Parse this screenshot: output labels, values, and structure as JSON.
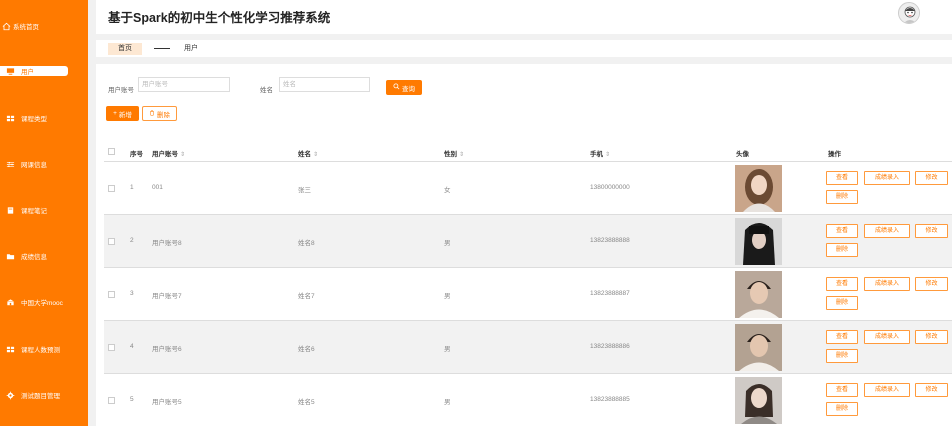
{
  "app": {
    "title": "基于Spark的初中生个性化学习推荐系统"
  },
  "sidebar": {
    "items": [
      {
        "label": "系统首页",
        "icon": "home-icon"
      },
      {
        "label": "用户",
        "icon": "monitor-icon"
      },
      {
        "label": "课程类型",
        "icon": "grid-icon"
      },
      {
        "label": "网课信息",
        "icon": "sliders-icon"
      },
      {
        "label": "课程笔记",
        "icon": "notebook-icon"
      },
      {
        "label": "成绩信息",
        "icon": "folder-icon"
      },
      {
        "label": "中国大学mooc",
        "icon": "school-icon"
      },
      {
        "label": "课程人数预测",
        "icon": "grid-icon"
      },
      {
        "label": "测试题目管理",
        "icon": "gear-icon"
      }
    ]
  },
  "tabs": {
    "home": "首页",
    "current": "用户"
  },
  "search": {
    "account_label": "用户账号",
    "account_placeholder": "用户账号",
    "name_label": "姓名",
    "name_placeholder": "姓名",
    "search_button": "查询"
  },
  "toolbar": {
    "add_label": "新增",
    "delete_label": "删除"
  },
  "table": {
    "headers": {
      "index": "序号",
      "account": "用户账号",
      "name": "姓名",
      "gender": "性别",
      "phone": "手机",
      "avatar": "头像",
      "ops": "操作"
    },
    "rows": [
      {
        "index": "1",
        "account": "001",
        "name": "张三",
        "gender": "女",
        "phone": "13800000000"
      },
      {
        "index": "2",
        "account": "用户账号8",
        "name": "姓名8",
        "gender": "男",
        "phone": "13823888888"
      },
      {
        "index": "3",
        "account": "用户账号7",
        "name": "姓名7",
        "gender": "男",
        "phone": "13823888887"
      },
      {
        "index": "4",
        "account": "用户账号6",
        "name": "姓名6",
        "gender": "男",
        "phone": "13823888886"
      },
      {
        "index": "5",
        "account": "用户账号5",
        "name": "姓名5",
        "gender": "男",
        "phone": "13823888885"
      }
    ],
    "op_labels": {
      "view": "查看",
      "score": "成绩录入",
      "edit": "修改",
      "delete": "删除"
    }
  },
  "colors": {
    "accent": "#ff7a00",
    "sidebar": "#ff7a00"
  }
}
